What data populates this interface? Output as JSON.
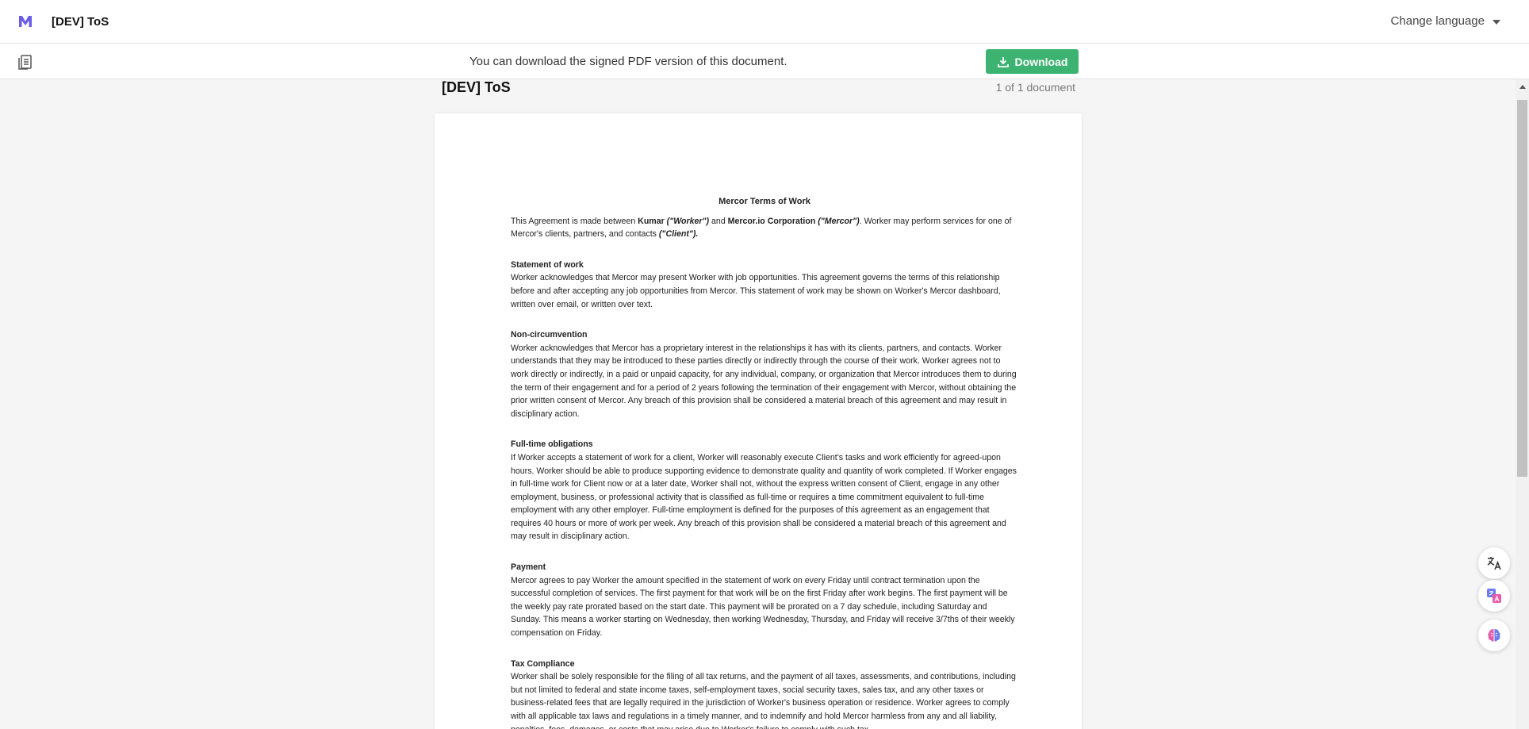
{
  "header": {
    "logo_icon": "mercor-logo-icon",
    "title": "[DEV] ToS",
    "language_label": "Change language"
  },
  "subbar": {
    "document_icon": "documents-icon",
    "notice": "You can download the signed PDF version of this document.",
    "download_label": "Download",
    "download_color": "#3cb371"
  },
  "viewer": {
    "title": "[DEV] ToS",
    "count": "1 of 1 document"
  },
  "document": {
    "title": "Mercor Terms of Work",
    "intro": {
      "t1": "This Agreement is made between ",
      "worker_name": "Kumar",
      "worker_alias": " (\"Worker\")",
      "t2": " and ",
      "company_name": "Mercor.io Corporation",
      "company_alias": " (\"Mercor\")",
      "t3": ". Worker may perform services for one of Mercor's clients, partners, and contacts ",
      "client_alias": "(\"Client\")."
    },
    "sections": [
      {
        "title": "Statement of work",
        "body": "Worker acknowledges that Mercor may present Worker with job opportunities. This agreement governs the terms of this relationship before and after accepting any job opportunities from Mercor. This statement of work may be shown on Worker's Mercor dashboard, written over email, or written over text."
      },
      {
        "title": "Non-circumvention",
        "body": "Worker acknowledges that Mercor has a proprietary interest in the relationships it has with its clients, partners, and contacts. Worker understands that they may be introduced to these parties directly or indirectly through the course of their work. Worker agrees not to work directly or indirectly, in a paid or unpaid capacity, for any individual, company, or organization that Mercor introduces them to during the term of their engagement and for a period of 2 years following the termination of their engagement with Mercor, without obtaining the prior written consent of Mercor. Any breach of this provision shall be considered a material breach of this agreement and may result in disciplinary action."
      },
      {
        "title": "Full-time obligations",
        "body": "If Worker accepts a statement of work for a client, Worker will reasonably execute Client's tasks and work efficiently for agreed-upon hours. Worker should be able to produce supporting evidence to demonstrate quality and quantity of work completed. If Worker engages in full-time work for Client now or at a later date, Worker shall not, without the express written consent of Client, engage in any other employment, business, or professional activity that is classified as full-time or requires a time commitment equivalent to full-time employment with any other employer. Full-time employment is defined for the purposes of this agreement as an engagement that requires 40 hours or more of work per week. Any breach of this provision shall be considered a material breach of this agreement and may result in disciplinary action."
      },
      {
        "title": "Payment",
        "body": "Mercor agrees to pay Worker the amount specified in the statement of work on every Friday until contract termination upon the successful completion of services. The first payment for that work will be on the first Friday after work begins. The first payment will be the weekly pay rate prorated based on the start date. This payment will be prorated on a 7 day schedule, including Saturday and Sunday. This means a worker starting on Wednesday, then working Wednesday, Thursday, and Friday will receive 3/7ths of their weekly compensation on Friday."
      },
      {
        "title": "Tax Compliance",
        "body": "Worker shall be solely responsible for the filing of all tax returns, and the payment of all taxes, assessments, and contributions, including but not limited to federal and state income taxes, self-employment taxes, social security taxes, sales tax, and any other taxes or business-related fees that are legally required in the jurisdiction of Worker's business operation or residence. Worker agrees to comply with all applicable tax laws and regulations in a timely manner, and to indemnify and hold Mercor harmless from any and all liability, penalties, fees, damages, or costs that may arise due to Worker's failure to comply with such tax"
      }
    ]
  },
  "widgets": [
    "translate-icon",
    "ai-translate-icon",
    "brain-icon"
  ]
}
